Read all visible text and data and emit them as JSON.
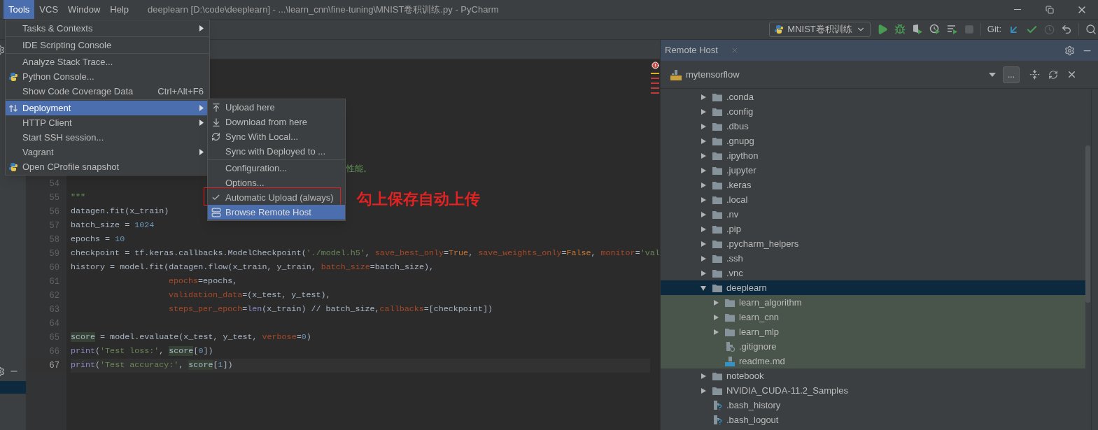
{
  "menubar": [
    {
      "label": "Tools",
      "selected": true
    },
    {
      "label": "VCS",
      "selected": false
    },
    {
      "label": "Window",
      "selected": false
    },
    {
      "label": "Help",
      "selected": false
    }
  ],
  "window": {
    "title": "deeplearn [D:\\code\\deeplearn] - ...\\learn_cnn\\fine-tuning\\MNIST卷积训练.py - PyCharm"
  },
  "toolbar": {
    "run_config": "MNIST卷积训练",
    "git_label": "Git:"
  },
  "tools_menu": [
    {
      "kind": "item",
      "label": "Tasks & Contexts",
      "submenu": true,
      "selected": false
    },
    {
      "kind": "separator"
    },
    {
      "kind": "item",
      "label": "IDE Scripting Console",
      "submenu": false,
      "selected": false
    },
    {
      "kind": "separator"
    },
    {
      "kind": "item",
      "label": "Analyze Stack Trace...",
      "submenu": false,
      "selected": false
    },
    {
      "kind": "item",
      "label": "Python Console...",
      "submenu": false,
      "selected": false
    },
    {
      "kind": "item",
      "label": "Show Code Coverage Data",
      "shortcut": "Ctrl+Alt+F6",
      "submenu": false,
      "selected": false
    },
    {
      "kind": "separator"
    },
    {
      "kind": "item",
      "label": "Deployment",
      "submenu": true,
      "selected": true
    },
    {
      "kind": "item",
      "label": "HTTP Client",
      "submenu": true,
      "selected": false
    },
    {
      "kind": "item",
      "label": "Start SSH session...",
      "submenu": false,
      "selected": false
    },
    {
      "kind": "item",
      "label": "Vagrant",
      "submenu": true,
      "selected": false
    },
    {
      "kind": "item",
      "label": "Open CProfile snapshot",
      "submenu": false,
      "selected": false
    }
  ],
  "deployment_menu": [
    {
      "kind": "item",
      "label": "Upload here",
      "selected": false,
      "boxed": false
    },
    {
      "kind": "item",
      "label": "Download from here",
      "selected": false,
      "boxed": false
    },
    {
      "kind": "item",
      "label": "Sync With Local...",
      "selected": false,
      "boxed": false
    },
    {
      "kind": "item",
      "label": "Sync with Deployed to ...",
      "selected": false,
      "boxed": false
    },
    {
      "kind": "separator"
    },
    {
      "kind": "item",
      "label": "Configuration...",
      "selected": false,
      "boxed": false
    },
    {
      "kind": "item",
      "label": "Options...",
      "selected": false,
      "boxed": false
    },
    {
      "kind": "toggle",
      "label": "Automatic Upload (always)",
      "checked": true,
      "selected": false,
      "boxed": true
    },
    {
      "kind": "item",
      "label": "Browse Remote Host",
      "selected": true,
      "boxed": false
    }
  ],
  "annotation": {
    "text": "勾上保存自动上传"
  },
  "editor": {
    "lines": [
      {
        "kind": "fragment",
        "tokens": [
          {
            "kind": "comment",
            "text": "性能。"
          }
        ]
      },
      {
        "kind": "blank",
        "number": "54"
      },
      {
        "kind": "code",
        "number": "55",
        "tokens": [
          {
            "kind": "doc",
            "text": "\"\"\""
          }
        ]
      },
      {
        "kind": "code",
        "number": "56",
        "tokens": [
          {
            "kind": "plain",
            "text": "datagen.fit(x_train)"
          }
        ]
      },
      {
        "kind": "code",
        "number": "57",
        "tokens": [
          {
            "kind": "plain",
            "text": "batch_size = "
          },
          {
            "kind": "num",
            "text": "1024"
          }
        ]
      },
      {
        "kind": "code",
        "number": "58",
        "tokens": [
          {
            "kind": "plain",
            "text": "epochs = "
          },
          {
            "kind": "num",
            "text": "10"
          }
        ]
      },
      {
        "kind": "code",
        "number": "59",
        "tokens": [
          {
            "kind": "plain",
            "text": "checkpoint = tf.keras.callbacks.ModelCheckpoint("
          },
          {
            "kind": "str",
            "text": "'./model.h5'"
          },
          {
            "kind": "plain",
            "text": ", "
          },
          {
            "kind": "param",
            "text": "save_best_only"
          },
          {
            "kind": "plain",
            "text": "="
          },
          {
            "kind": "kw",
            "text": "True"
          },
          {
            "kind": "plain",
            "text": ", "
          },
          {
            "kind": "param",
            "text": "save_weights_only"
          },
          {
            "kind": "plain",
            "text": "="
          },
          {
            "kind": "kw",
            "text": "False"
          },
          {
            "kind": "plain",
            "text": ", "
          },
          {
            "kind": "param",
            "text": "monitor"
          },
          {
            "kind": "plain",
            "text": "="
          },
          {
            "kind": "str",
            "text": "'val"
          }
        ]
      },
      {
        "kind": "code",
        "number": "60",
        "tokens": [
          {
            "kind": "plain",
            "text": "history = model.fit(datagen.flow(x_train, y_train, "
          },
          {
            "kind": "param",
            "text": "batch_size"
          },
          {
            "kind": "plain",
            "text": "=batch_size),"
          }
        ]
      },
      {
        "kind": "continuation",
        "number": "61",
        "tokens": [
          {
            "kind": "param",
            "text": "epochs"
          },
          {
            "kind": "plain",
            "text": "=epochs,"
          }
        ]
      },
      {
        "kind": "continuation",
        "number": "62",
        "tokens": [
          {
            "kind": "param",
            "text": "validation_data"
          },
          {
            "kind": "plain",
            "text": "=(x_test, y_test),"
          }
        ]
      },
      {
        "kind": "continuation",
        "number": "63",
        "tokens": [
          {
            "kind": "param",
            "text": "steps_per_epoch"
          },
          {
            "kind": "plain",
            "text": "="
          },
          {
            "kind": "builtin",
            "text": "len"
          },
          {
            "kind": "plain",
            "text": "(x_train) // batch_size,"
          },
          {
            "kind": "param",
            "text": "callbacks"
          },
          {
            "kind": "plain",
            "text": "=[checkpoint])"
          }
        ]
      },
      {
        "kind": "blank",
        "number": "64"
      },
      {
        "kind": "code",
        "number": "65",
        "tokens": [
          {
            "kind": "hl",
            "text": "score"
          },
          {
            "kind": "plain",
            "text": " = model.evaluate(x_test, y_test, "
          },
          {
            "kind": "param",
            "text": "verbose"
          },
          {
            "kind": "plain",
            "text": "="
          },
          {
            "kind": "num",
            "text": "0"
          },
          {
            "kind": "plain",
            "text": ")"
          }
        ]
      },
      {
        "kind": "code",
        "number": "66",
        "tokens": [
          {
            "kind": "builtin",
            "text": "print"
          },
          {
            "kind": "plain",
            "text": "("
          },
          {
            "kind": "str",
            "text": "'Test loss:'"
          },
          {
            "kind": "plain",
            "text": ", "
          },
          {
            "kind": "hl",
            "text": "score"
          },
          {
            "kind": "plain",
            "text": "["
          },
          {
            "kind": "num",
            "text": "0"
          },
          {
            "kind": "plain",
            "text": "])"
          }
        ]
      },
      {
        "kind": "current",
        "number": "67",
        "tokens": [
          {
            "kind": "builtin",
            "text": "print"
          },
          {
            "kind": "plain",
            "text": "("
          },
          {
            "kind": "str",
            "text": "'Test accuracy:'"
          },
          {
            "kind": "plain",
            "text": ", "
          },
          {
            "kind": "hl",
            "text": "score"
          },
          {
            "kind": "plain",
            "text": "["
          },
          {
            "kind": "num",
            "text": "1"
          },
          {
            "kind": "plain",
            "text": "])"
          }
        ]
      }
    ]
  },
  "remote_host": {
    "tab": "Remote Host",
    "server": "mytensorflow",
    "more_button": "...",
    "tree": [
      {
        "name": ".conda",
        "kind": "folder",
        "expanded": false,
        "selected": false,
        "highlighted": false
      },
      {
        "name": ".config",
        "kind": "folder",
        "expanded": false,
        "selected": false,
        "highlighted": false
      },
      {
        "name": ".dbus",
        "kind": "folder",
        "expanded": false,
        "selected": false,
        "highlighted": false
      },
      {
        "name": ".gnupg",
        "kind": "folder",
        "expanded": false,
        "selected": false,
        "highlighted": false
      },
      {
        "name": ".ipython",
        "kind": "folder",
        "expanded": false,
        "selected": false,
        "highlighted": false
      },
      {
        "name": ".jupyter",
        "kind": "folder",
        "expanded": false,
        "selected": false,
        "highlighted": false
      },
      {
        "name": ".keras",
        "kind": "folder",
        "expanded": false,
        "selected": false,
        "highlighted": false
      },
      {
        "name": ".local",
        "kind": "folder",
        "expanded": false,
        "selected": false,
        "highlighted": false
      },
      {
        "name": ".nv",
        "kind": "folder",
        "expanded": false,
        "selected": false,
        "highlighted": false
      },
      {
        "name": ".pip",
        "kind": "folder",
        "expanded": false,
        "selected": false,
        "highlighted": false
      },
      {
        "name": ".pycharm_helpers",
        "kind": "folder",
        "expanded": false,
        "selected": false,
        "highlighted": false
      },
      {
        "name": ".ssh",
        "kind": "folder",
        "expanded": false,
        "selected": false,
        "highlighted": false
      },
      {
        "name": ".vnc",
        "kind": "folder",
        "expanded": false,
        "selected": false,
        "highlighted": false
      },
      {
        "name": "deeplearn",
        "kind": "folder",
        "expanded": true,
        "selected": true,
        "highlighted": false,
        "children": [
          {
            "name": "learn_algorithm",
            "kind": "folder",
            "expanded": false,
            "selected": false,
            "highlighted": true
          },
          {
            "name": "learn_cnn",
            "kind": "folder",
            "expanded": false,
            "selected": false,
            "highlighted": true
          },
          {
            "name": "learn_mlp",
            "kind": "folder",
            "expanded": false,
            "selected": false,
            "highlighted": true
          },
          {
            "name": ".gitignore",
            "kind": "ignore",
            "selected": false,
            "highlighted": true
          },
          {
            "name": "readme.md",
            "kind": "markdown",
            "selected": false,
            "highlighted": true
          }
        ]
      },
      {
        "name": "notebook",
        "kind": "folder",
        "expanded": false,
        "selected": false,
        "highlighted": false
      },
      {
        "name": "NVIDIA_CUDA-11.2_Samples",
        "kind": "folder",
        "expanded": false,
        "selected": false,
        "highlighted": false
      },
      {
        "name": ".bash_history",
        "kind": "unknown",
        "selected": false,
        "highlighted": false
      },
      {
        "name": ".bash_logout",
        "kind": "unknown",
        "selected": false,
        "highlighted": false
      }
    ]
  }
}
